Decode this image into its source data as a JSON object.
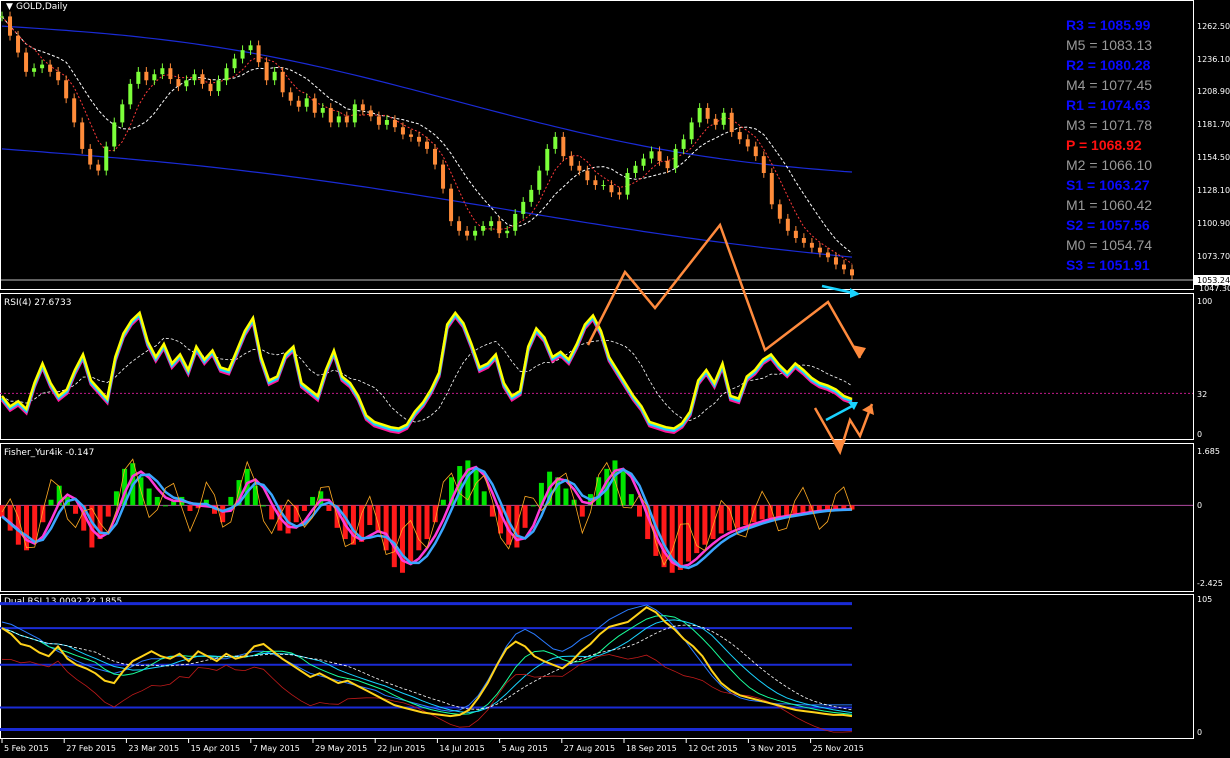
{
  "window": {
    "title": "GOLD,Daily"
  },
  "chart_data": [
    {
      "type": "line",
      "panel": "price",
      "title": "GOLD,Daily",
      "y_ticks": [
        1262.5,
        1236.1,
        1208.9,
        1181.7,
        1154.5,
        1128.1,
        1100.9,
        1073.7
      ],
      "current_price_label": "1053.24",
      "low_label": "1047.30",
      "ylim": [
        1045,
        1275
      ],
      "series": [
        {
          "name": "close",
          "color": "#ff8c3a",
          "values": [
            1268,
            1252,
            1238,
            1222,
            1225,
            1228,
            1222,
            1215,
            1200,
            1180,
            1158,
            1145,
            1140,
            1160,
            1180,
            1195,
            1212,
            1222,
            1215,
            1220,
            1225,
            1216,
            1210,
            1215,
            1220,
            1212,
            1206,
            1215,
            1225,
            1233,
            1240,
            1244,
            1230,
            1215,
            1222,
            1205,
            1198,
            1193,
            1200,
            1188,
            1192,
            1180,
            1185,
            1180,
            1195,
            1190,
            1185,
            1178,
            1182,
            1176,
            1170,
            1168,
            1164,
            1158,
            1145,
            1125,
            1098,
            1090,
            1086,
            1090,
            1094,
            1098,
            1088,
            1090,
            1104,
            1114,
            1124,
            1140,
            1158,
            1168,
            1152,
            1144,
            1140,
            1132,
            1128,
            1128,
            1122,
            1120,
            1138,
            1144,
            1150,
            1156,
            1148,
            1142,
            1158,
            1166,
            1180,
            1192,
            1183,
            1178,
            1188,
            1172,
            1166,
            1160,
            1152,
            1138,
            1112,
            1100,
            1090,
            1084,
            1080,
            1076,
            1072,
            1068,
            1062,
            1058,
            1053
          ]
        }
      ],
      "pivot_levels": [
        {
          "label": "R3 = 1085.99",
          "color": "#0a0aff"
        },
        {
          "label": "M5 = 1083.13",
          "color": "#9a9a9a"
        },
        {
          "label": "R2 = 1080.28",
          "color": "#0a0aff"
        },
        {
          "label": "M4 = 1077.45",
          "color": "#9a9a9a"
        },
        {
          "label": "R1 = 1074.63",
          "color": "#0a0aff"
        },
        {
          "label": "M3 = 1071.78",
          "color": "#9a9a9a"
        },
        {
          "label": "P  = 1068.92",
          "color": "#ff1010"
        },
        {
          "label": "M2 = 1066.10",
          "color": "#9a9a9a"
        },
        {
          "label": "S1 = 1063.27",
          "color": "#0a0aff"
        },
        {
          "label": "M1 = 1060.42",
          "color": "#9a9a9a"
        },
        {
          "label": "S2 = 1057.56",
          "color": "#0a0aff"
        },
        {
          "label": "M0 = 1054.74",
          "color": "#9a9a9a"
        },
        {
          "label": "S3 = 1051.91",
          "color": "#0a0aff"
        }
      ]
    },
    {
      "type": "line",
      "panel": "rsi",
      "title": "RSI(4) 27.6733",
      "y_ticks": [
        100,
        32,
        0
      ],
      "ylim": [
        0,
        100
      ],
      "series": [
        {
          "name": "RSI(4)",
          "color": "#ffff00",
          "values": [
            30,
            22,
            26,
            20,
            40,
            55,
            40,
            30,
            35,
            50,
            62,
            42,
            35,
            28,
            60,
            78,
            88,
            94,
            72,
            60,
            70,
            55,
            62,
            50,
            68,
            58,
            65,
            52,
            50,
            65,
            80,
            90,
            60,
            42,
            45,
            62,
            68,
            40,
            35,
            30,
            50,
            65,
            45,
            40,
            30,
            15,
            10,
            8,
            6,
            5,
            8,
            18,
            25,
            35,
            48,
            85,
            94,
            86,
            70,
            52,
            55,
            62,
            40,
            30,
            34,
            68,
            82,
            75,
            60,
            64,
            58,
            70,
            85,
            92,
            80,
            60,
            50,
            40,
            30,
            22,
            10,
            8,
            6,
            5,
            9,
            18,
            42,
            50,
            40,
            55,
            30,
            28,
            45,
            50,
            58,
            62,
            54,
            48,
            55,
            50,
            44,
            40,
            38,
            35,
            30,
            27.7
          ]
        }
      ]
    },
    {
      "type": "bar",
      "panel": "fisher",
      "title": "Fisher_Yur4ik -0.147",
      "y_ticks": [
        1.685,
        0.0,
        -2.425
      ],
      "ylim": [
        -2.8,
        1.9
      ],
      "series": [
        {
          "name": "Fisher_Yur4ik",
          "color": "#00ff00",
          "values": [
            -0.4,
            -0.9,
            -1.4,
            -1.6,
            -1.3,
            -0.6,
            0.2,
            0.7,
            0.3,
            -0.3,
            -0.9,
            -1.5,
            -1.2,
            -0.4,
            0.5,
            1.3,
            1.5,
            1.0,
            0.6,
            0.3,
            0.0,
            0.2,
            0.3,
            -0.2,
            -0.1,
            0.2,
            -0.3,
            -0.6,
            0.3,
            0.9,
            1.3,
            0.7,
            0.0,
            -0.5,
            -0.9,
            -1.0,
            -0.6,
            -0.2,
            0.3,
            0.5,
            -0.2,
            -0.8,
            -1.2,
            -1.4,
            -1.3,
            -0.7,
            -0.9,
            -1.6,
            -2.2,
            -2.4,
            -2.0,
            -1.6,
            -1.2,
            -0.6,
            0.2,
            1.0,
            1.4,
            1.6,
            1.3,
            0.5,
            -0.4,
            -1.0,
            -1.4,
            -1.5,
            -0.8,
            0.0,
            0.8,
            1.2,
            1.0,
            0.6,
            0.2,
            -0.4,
            0.4,
            1.0,
            1.3,
            1.6,
            1.2,
            0.4,
            -0.4,
            -1.2,
            -1.8,
            -2.2,
            -2.4,
            -2.3,
            -2.0,
            -1.7,
            -1.4,
            -1.2,
            -1.0,
            -0.9,
            -0.8,
            -0.7,
            -0.6,
            -0.5,
            -0.45,
            -0.4,
            -0.35,
            -0.3,
            -0.25,
            -0.2,
            -0.18,
            -0.16,
            -0.15,
            -0.15,
            -0.147
          ]
        }
      ]
    },
    {
      "type": "line",
      "panel": "dual-rsi",
      "title": "Dual RSI 13.0092 22.1855",
      "y_ticks": [
        105,
        0
      ],
      "ylim": [
        0,
        108
      ],
      "series": [
        {
          "name": "RSI 1",
          "color": "#ffd21a",
          "values": [
            85,
            80,
            72,
            70,
            65,
            62,
            70,
            60,
            55,
            52,
            48,
            42,
            40,
            50,
            58,
            62,
            66,
            62,
            60,
            64,
            58,
            66,
            62,
            58,
            64,
            60,
            62,
            70,
            72,
            66,
            60,
            55,
            50,
            45,
            48,
            44,
            40,
            42,
            38,
            34,
            30,
            26,
            22,
            20,
            18,
            16,
            15,
            14,
            13,
            14,
            18,
            28,
            40,
            55,
            68,
            74,
            70,
            62,
            58,
            55,
            52,
            58,
            66,
            72,
            80,
            86,
            88,
            90,
            96,
            102,
            98,
            90,
            84,
            76,
            70,
            62,
            50,
            40,
            34,
            30,
            28,
            26,
            24,
            22,
            20,
            18,
            17,
            16,
            15,
            14,
            14,
            13.0
          ]
        },
        {
          "name": "RSI 2",
          "color": "#2a7bff",
          "values": [
            90,
            88,
            84,
            80,
            76,
            70,
            66,
            62,
            58,
            55,
            52,
            50,
            48,
            50,
            54,
            58,
            60,
            60,
            62,
            62,
            60,
            62,
            62,
            60,
            60,
            62,
            64,
            66,
            66,
            64,
            60,
            56,
            52,
            48,
            46,
            44,
            42,
            40,
            38,
            36,
            34,
            30,
            28,
            26,
            24,
            22,
            20,
            18,
            17,
            18,
            22,
            30,
            42,
            56,
            70,
            80,
            84,
            80,
            74,
            68,
            66,
            70,
            76,
            80,
            86,
            92,
            96,
            100,
            102,
            104,
            100,
            94,
            86,
            76,
            66,
            56,
            46,
            38,
            32,
            28,
            26,
            25,
            24,
            23,
            23,
            22.5,
            22.2,
            22.2,
            22.2,
            22.2,
            22.2,
            22.2
          ]
        }
      ]
    }
  ],
  "date_axis": [
    "5 Feb 2015",
    "27 Feb 2015",
    "23 Mar 2015",
    "15 Apr 2015",
    "7 May 2015",
    "29 May 2015",
    "22 Jun 2015",
    "14 Jul 2015",
    "5 Aug 2015",
    "27 Aug 2015",
    "18 Sep 2015",
    "12 Oct 2015",
    "3 Nov 2015",
    "25 Nov 2015"
  ],
  "colors": {
    "background": "#000000",
    "bands": "#1a2bd6",
    "annotation_arrows": "#ff8a3d",
    "cyan_arrows": "#19d3ff",
    "dotted_level": "#c21a8a",
    "fisher_pos": "#00e400",
    "fisher_neg": "#ff1a1a"
  }
}
